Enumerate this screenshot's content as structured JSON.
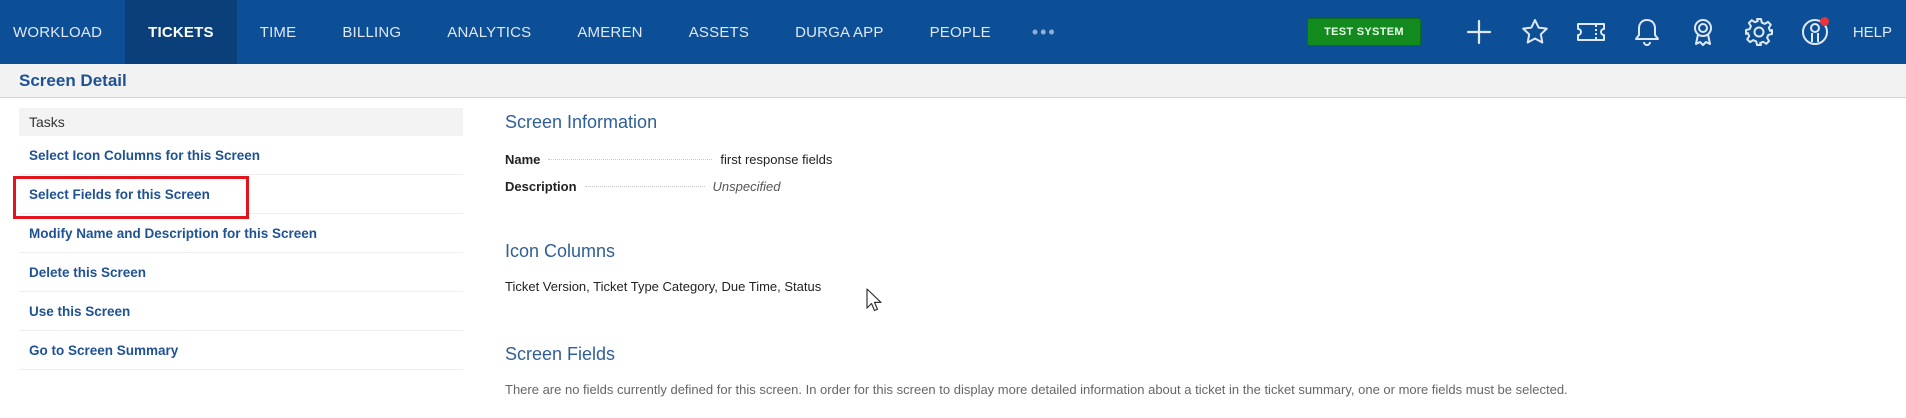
{
  "nav": {
    "items": [
      "WORKLOAD",
      "TICKETS",
      "TIME",
      "BILLING",
      "ANALYTICS",
      "AMEREN",
      "ASSETS",
      "DURGA APP",
      "PEOPLE"
    ],
    "active": "TICKETS",
    "more": "•••",
    "test_badge": "TEST SYSTEM",
    "icons": [
      "plus-icon",
      "star-icon",
      "ticket-icon",
      "bell-icon",
      "award-icon",
      "gear-icon",
      "user-icon"
    ],
    "help": "HELP",
    "colors": {
      "bar": "#0d4f96",
      "active": "#0a3f7a",
      "badge": "#128a1e",
      "dot": "#e8343a"
    }
  },
  "page": {
    "title": "Screen Detail"
  },
  "tasks": {
    "header": "Tasks",
    "items": [
      "Select Icon Columns for this Screen",
      "Select Fields for this Screen",
      "Modify Name and Description for this Screen",
      "Delete this Screen",
      "Use this Screen",
      "Go to Screen Summary"
    ],
    "highlighted_index": 1
  },
  "info": {
    "title": "Screen Information",
    "name_label": "Name",
    "name_value": "first response fields",
    "description_label": "Description",
    "description_value": "Unspecified"
  },
  "icon_columns": {
    "title": "Icon Columns",
    "value": "Ticket Version, Ticket Type Category, Due Time, Status"
  },
  "screen_fields": {
    "title": "Screen Fields",
    "note": "There are no fields currently defined for this screen. In order for this screen to display more detailed information about a ticket in the ticket summary, one or more fields must be selected."
  }
}
